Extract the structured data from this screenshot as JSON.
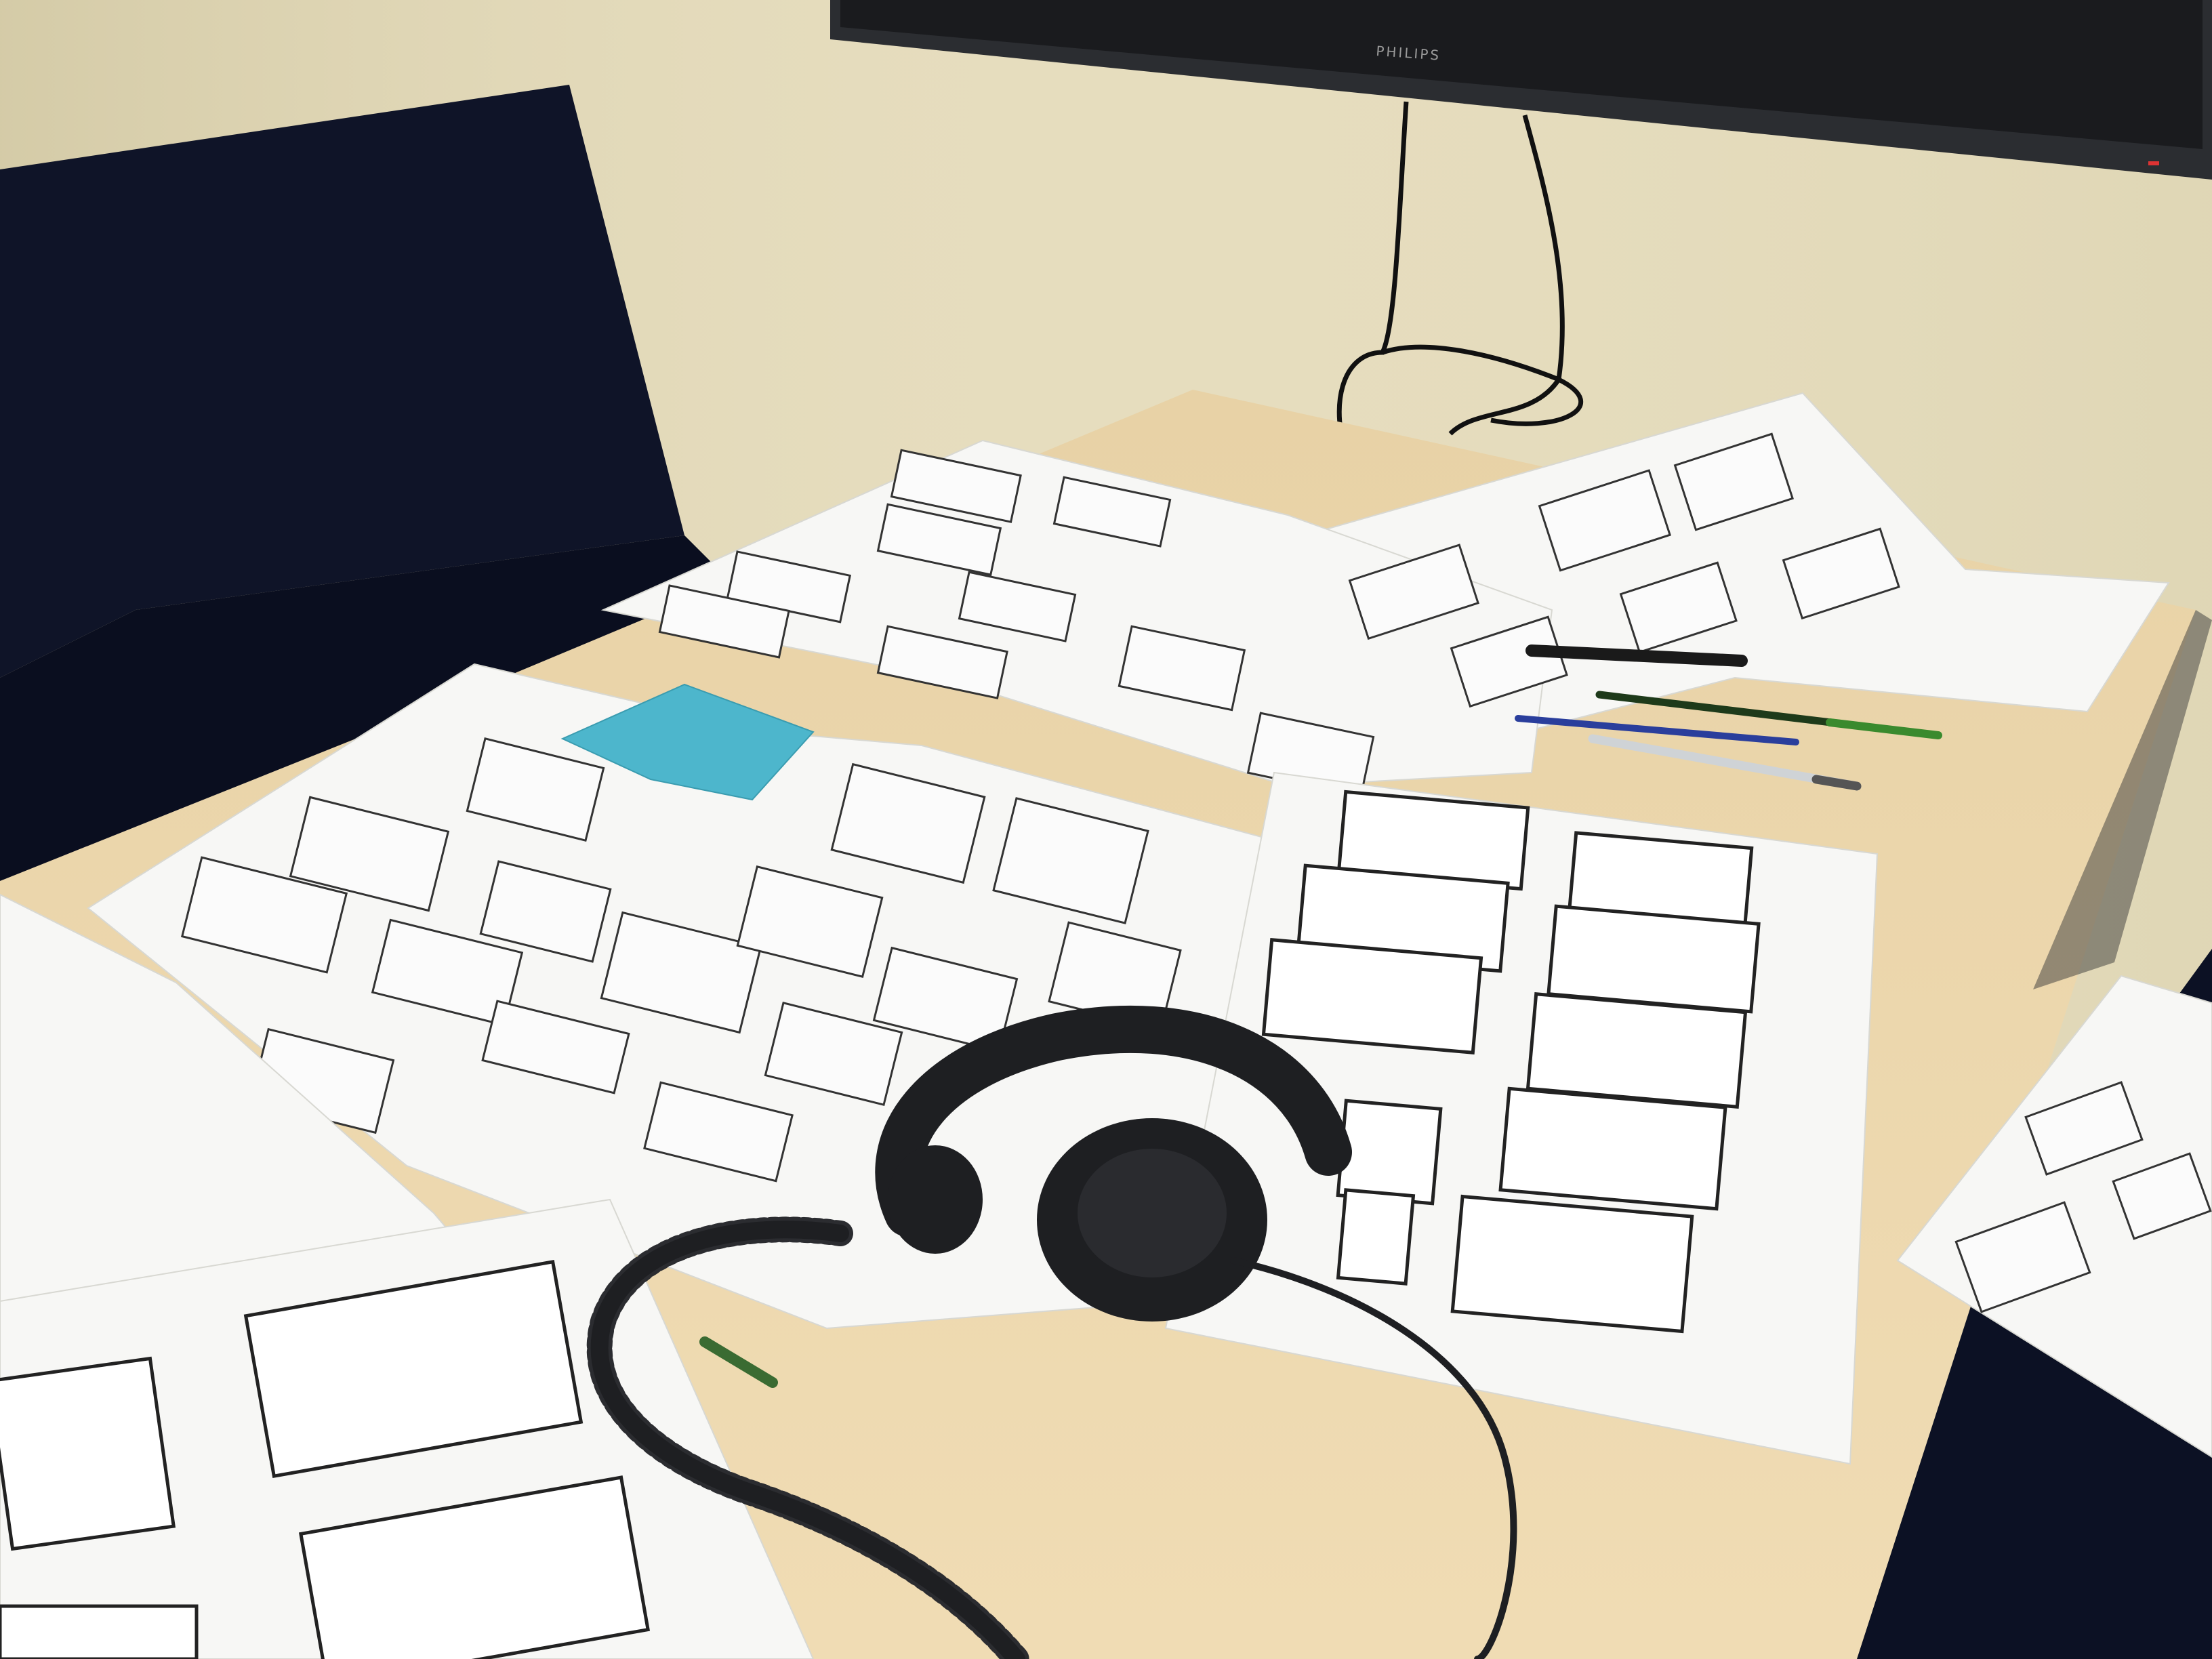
{
  "tv": {
    "brand": "PHILIPS"
  },
  "colors": {
    "wall": "#e6ddbe",
    "bench": "#0f1428",
    "table": "#ecd8b0",
    "paper": "#f7f7f5",
    "sticky_note": "#4db6cc",
    "headphones": "#1e1f22",
    "tv_frame": "#2b2d31"
  },
  "objects": [
    "tv-screen",
    "wall-cables",
    "navy-bench",
    "wooden-table",
    "wireframe-sheets",
    "storyboard-template-sheets",
    "blue-sticky-note",
    "headphones",
    "coiled-cable",
    "pens",
    "pen-cap"
  ]
}
